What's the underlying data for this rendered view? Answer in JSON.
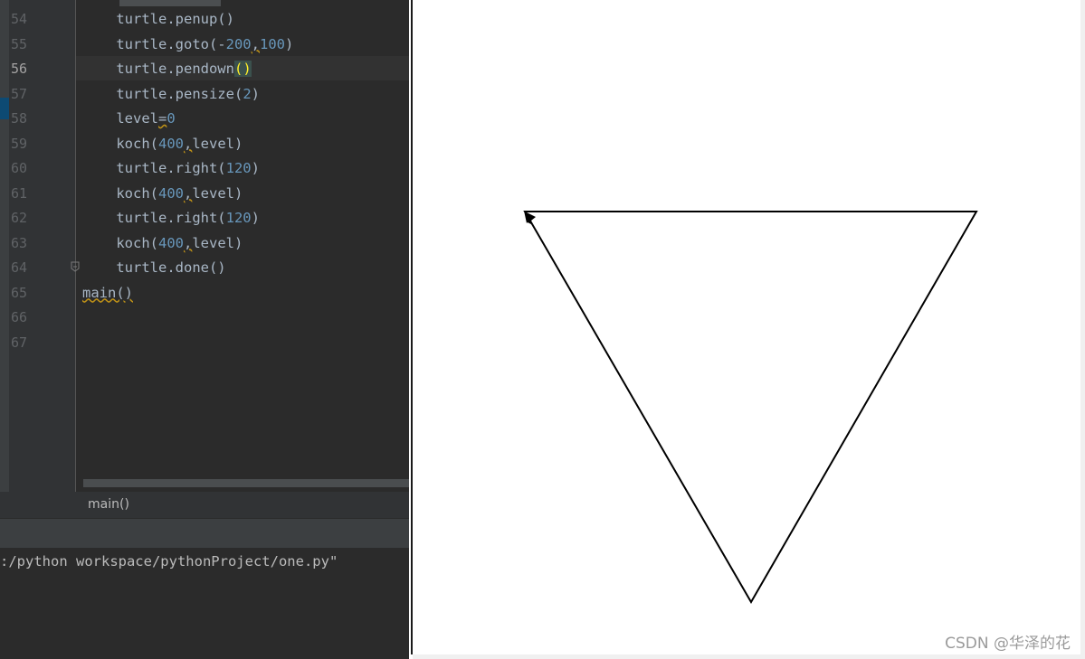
{
  "editor": {
    "current_line": "56",
    "lines": [
      {
        "num": "54",
        "parts": [
          {
            "t": "    turtle.penup()"
          }
        ]
      },
      {
        "num": "55",
        "parts": [
          {
            "t": "    turtle.goto(-"
          },
          {
            "t": "200",
            "c": "num"
          },
          {
            "t": ",",
            "c": "warn"
          },
          {
            "t": "100",
            "c": "num"
          },
          {
            "t": ")"
          }
        ]
      },
      {
        "num": "56",
        "parts": [
          {
            "t": "    turtle.pendown"
          },
          {
            "t": "()",
            "c": "paren-hl"
          }
        ]
      },
      {
        "num": "57",
        "parts": [
          {
            "t": "    turtle.pensize("
          },
          {
            "t": "2",
            "c": "num"
          },
          {
            "t": ")"
          }
        ]
      },
      {
        "num": "58",
        "parts": [
          {
            "t": "    level"
          },
          {
            "t": "=",
            "c": "warn"
          },
          {
            "t": "0",
            "c": "num"
          }
        ]
      },
      {
        "num": "59",
        "parts": [
          {
            "t": "    koch("
          },
          {
            "t": "400",
            "c": "num"
          },
          {
            "t": ",",
            "c": "warn"
          },
          {
            "t": "level)"
          }
        ]
      },
      {
        "num": "60",
        "parts": [
          {
            "t": "    turtle.right("
          },
          {
            "t": "120",
            "c": "num"
          },
          {
            "t": ")"
          }
        ]
      },
      {
        "num": "61",
        "parts": [
          {
            "t": "    koch("
          },
          {
            "t": "400",
            "c": "num"
          },
          {
            "t": ",",
            "c": "warn"
          },
          {
            "t": "level)"
          }
        ]
      },
      {
        "num": "62",
        "parts": [
          {
            "t": "    turtle.right("
          },
          {
            "t": "120",
            "c": "num"
          },
          {
            "t": ")"
          }
        ]
      },
      {
        "num": "63",
        "parts": [
          {
            "t": "    koch("
          },
          {
            "t": "400",
            "c": "num"
          },
          {
            "t": ",",
            "c": "warn"
          },
          {
            "t": "level)"
          }
        ]
      },
      {
        "num": "64",
        "parts": [
          {
            "t": "    turtle.done()"
          }
        ]
      },
      {
        "num": "65",
        "parts": [
          {
            "t": "main()",
            "c": "warn"
          }
        ]
      },
      {
        "num": "66",
        "parts": []
      },
      {
        "num": "67",
        "parts": []
      }
    ]
  },
  "breadcrumb": "main()",
  "console": {
    "output": ":/python workspace/pythonProject/one.py\""
  },
  "turtle": {
    "shape": "downward equilateral triangle drawn by turtle",
    "pen_color": "#000000",
    "cursor_icon": "turtle-arrow-icon"
  },
  "watermark": "CSDN @华泽的花",
  "colors": {
    "ide_background": "#2b2b2b",
    "keyword_number": "#6897bb",
    "code_text": "#a9b7c6",
    "canvas_background": "#ffffff"
  }
}
